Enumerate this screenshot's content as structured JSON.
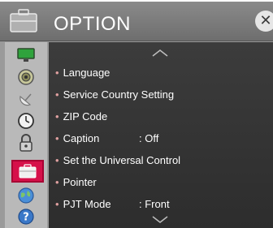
{
  "header": {
    "title": "OPTION",
    "icon": "briefcase-icon",
    "close_label": "✕"
  },
  "sidebar": {
    "items": [
      {
        "name": "picture",
        "icon": "monitor-icon"
      },
      {
        "name": "sound",
        "icon": "speaker-icon"
      },
      {
        "name": "setup",
        "icon": "satellite-dish-icon"
      },
      {
        "name": "time",
        "icon": "clock-icon"
      },
      {
        "name": "lock",
        "icon": "lock-icon"
      },
      {
        "name": "option",
        "icon": "briefcase-icon",
        "active": true
      },
      {
        "name": "network",
        "icon": "globe-icon"
      },
      {
        "name": "support",
        "icon": "help-icon"
      }
    ]
  },
  "menu": {
    "bullet": "•",
    "items": [
      {
        "label": "Language",
        "value": ""
      },
      {
        "label": "Service Country Setting",
        "value": ""
      },
      {
        "label": "ZIP Code",
        "value": ""
      },
      {
        "label": "Caption",
        "value": ": Off"
      },
      {
        "label": "Set the Universal Control",
        "value": ""
      },
      {
        "label": "Pointer",
        "value": ""
      },
      {
        "label": "PJT Mode",
        "value": ": Front"
      }
    ]
  },
  "colors": {
    "accent": "#d6104a",
    "content_bg": "#333333",
    "sidebar_bg": "#b9b9b9"
  }
}
